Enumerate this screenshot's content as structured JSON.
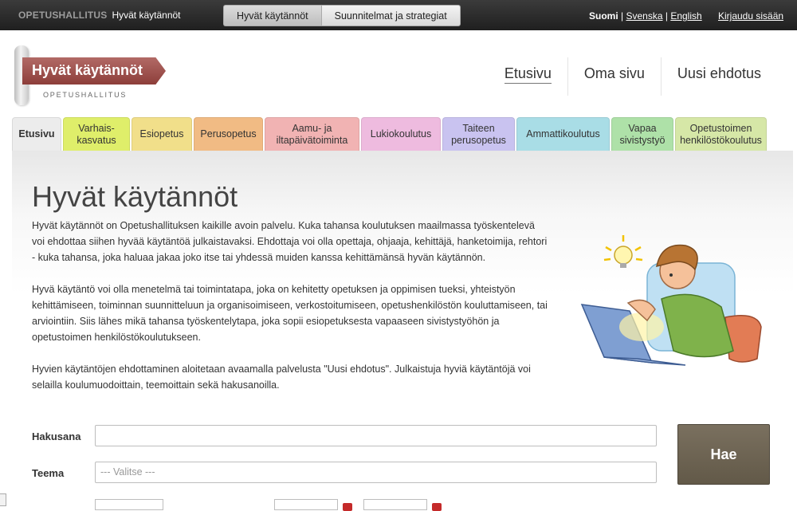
{
  "topbar": {
    "org": "OPETUSHALLITUS",
    "service": "Hyvät käytännöt",
    "nav": [
      "Hyvät käytännöt",
      "Suunnitelmat ja strategiat"
    ],
    "lang_current": "Suomi",
    "lang_sv": "Svenska",
    "lang_en": "English",
    "separator": "|",
    "login": "Kirjaudu sisään"
  },
  "logo": {
    "title": "Hyvät käytännöt",
    "subtitle": "OPETUSHALLITUS"
  },
  "mainnav": [
    "Etusivu",
    "Oma sivu",
    "Uusi ehdotus"
  ],
  "tabs": [
    {
      "line1": "Etusivu",
      "line2": ""
    },
    {
      "line1": "Varhais-",
      "line2": "kasvatus"
    },
    {
      "line1": "Esiopetus",
      "line2": ""
    },
    {
      "line1": "Perusopetus",
      "line2": ""
    },
    {
      "line1": "Aamu- ja",
      "line2": "iltapäivätoiminta"
    },
    {
      "line1": "Lukiokoulutus",
      "line2": ""
    },
    {
      "line1": "Taiteen",
      "line2": "perusopetus"
    },
    {
      "line1": "Ammattikoulutus",
      "line2": ""
    },
    {
      "line1": "Vapaa",
      "line2": "sivistystyö"
    },
    {
      "line1": "Opetustoimen",
      "line2": "henkilöstökoulutus"
    }
  ],
  "main": {
    "title": "Hyvät käytännöt",
    "paragraphs": [
      "Hyvät käytännöt on Opetushallituksen kaikille avoin palvelu. Kuka tahansa koulutuksen maailmassa työskentelevä voi ehdottaa siihen hyvää käytäntöä julkaistavaksi. Ehdottaja voi olla opettaja, ohjaaja, kehittäjä, hanketoimija, rehtori - kuka tahansa, joka haluaa jakaa joko itse tai yhdessä muiden kanssa kehittämänsä hyvän käytännön.",
      "Hyvä käytäntö voi olla menetelmä tai toimintatapa, joka on kehitetty opetuksen ja oppimisen tueksi, yhteistyön kehittämiseen, toiminnan suunnitteluun ja organisoimiseen, verkostoitumiseen, opetushenkilöstön kouluttamiseen, tai arviointiin. Siis lähes mikä tahansa työskentelytapa, joka sopii esiopetuksesta vapaaseen sivistystyöhön ja opetustoimen henkilöstökoulutukseen.",
      "Hyvien käytäntöjen ehdottaminen aloitetaan avaamalla palvelusta \"Uusi ehdotus\". Julkaistuja hyviä käytäntöjä voi selailla koulumuodoittain, teemoittain sekä hakusanoilla."
    ]
  },
  "form": {
    "search_label": "Hakusana",
    "search_value": "",
    "theme_label": "Teema",
    "theme_placeholder": "--- Valitse ---",
    "submit": "Hae"
  },
  "colors": {
    "brand": "#9e4f4b",
    "button": "#6d6453"
  }
}
